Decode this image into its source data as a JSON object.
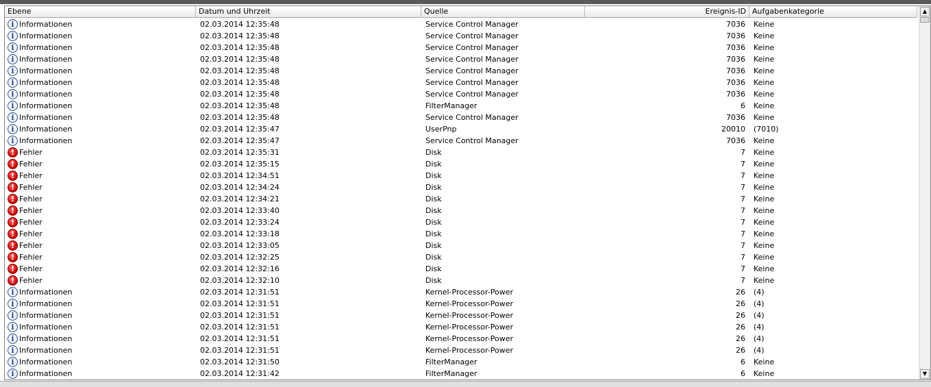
{
  "columns": [
    "Ebene",
    "Datum und Uhrzeit",
    "Quelle",
    "Ereignis-ID",
    "Aufgabenkategorie"
  ],
  "scroll": {
    "up_arrow": "▲",
    "down_arrow": "▼"
  },
  "rows": [
    {
      "level": "Informationen",
      "icon": "info-icon",
      "glyph": "i",
      "datetime": "02.03.2014 12:35:48",
      "source": "Service Control Manager",
      "id": "7036",
      "category": "Keine"
    },
    {
      "level": "Informationen",
      "icon": "info-icon",
      "glyph": "i",
      "datetime": "02.03.2014 12:35:48",
      "source": "Service Control Manager",
      "id": "7036",
      "category": "Keine"
    },
    {
      "level": "Informationen",
      "icon": "info-icon",
      "glyph": "i",
      "datetime": "02.03.2014 12:35:48",
      "source": "Service Control Manager",
      "id": "7036",
      "category": "Keine"
    },
    {
      "level": "Informationen",
      "icon": "info-icon",
      "glyph": "i",
      "datetime": "02.03.2014 12:35:48",
      "source": "Service Control Manager",
      "id": "7036",
      "category": "Keine"
    },
    {
      "level": "Informationen",
      "icon": "info-icon",
      "glyph": "i",
      "datetime": "02.03.2014 12:35:48",
      "source": "Service Control Manager",
      "id": "7036",
      "category": "Keine"
    },
    {
      "level": "Informationen",
      "icon": "info-icon",
      "glyph": "i",
      "datetime": "02.03.2014 12:35:48",
      "source": "Service Control Manager",
      "id": "7036",
      "category": "Keine"
    },
    {
      "level": "Informationen",
      "icon": "info-icon",
      "glyph": "i",
      "datetime": "02.03.2014 12:35:48",
      "source": "Service Control Manager",
      "id": "7036",
      "category": "Keine"
    },
    {
      "level": "Informationen",
      "icon": "info-icon",
      "glyph": "i",
      "datetime": "02.03.2014 12:35:48",
      "source": "FilterManager",
      "id": "6",
      "category": "Keine"
    },
    {
      "level": "Informationen",
      "icon": "info-icon",
      "glyph": "i",
      "datetime": "02.03.2014 12:35:48",
      "source": "Service Control Manager",
      "id": "7036",
      "category": "Keine"
    },
    {
      "level": "Informationen",
      "icon": "info-icon",
      "glyph": "i",
      "datetime": "02.03.2014 12:35:47",
      "source": "UserPnp",
      "id": "20010",
      "category": "(7010)"
    },
    {
      "level": "Informationen",
      "icon": "info-icon",
      "glyph": "i",
      "datetime": "02.03.2014 12:35:47",
      "source": "Service Control Manager",
      "id": "7036",
      "category": "Keine"
    },
    {
      "level": "Fehler",
      "icon": "error-icon",
      "glyph": "!",
      "datetime": "02.03.2014 12:35:31",
      "source": "Disk",
      "id": "7",
      "category": "Keine"
    },
    {
      "level": "Fehler",
      "icon": "error-icon",
      "glyph": "!",
      "datetime": "02.03.2014 12:35:15",
      "source": "Disk",
      "id": "7",
      "category": "Keine"
    },
    {
      "level": "Fehler",
      "icon": "error-icon",
      "glyph": "!",
      "datetime": "02.03.2014 12:34:51",
      "source": "Disk",
      "id": "7",
      "category": "Keine"
    },
    {
      "level": "Fehler",
      "icon": "error-icon",
      "glyph": "!",
      "datetime": "02.03.2014 12:34:24",
      "source": "Disk",
      "id": "7",
      "category": "Keine"
    },
    {
      "level": "Fehler",
      "icon": "error-icon",
      "glyph": "!",
      "datetime": "02.03.2014 12:34:21",
      "source": "Disk",
      "id": "7",
      "category": "Keine"
    },
    {
      "level": "Fehler",
      "icon": "error-icon",
      "glyph": "!",
      "datetime": "02.03.2014 12:33:40",
      "source": "Disk",
      "id": "7",
      "category": "Keine"
    },
    {
      "level": "Fehler",
      "icon": "error-icon",
      "glyph": "!",
      "datetime": "02.03.2014 12:33:24",
      "source": "Disk",
      "id": "7",
      "category": "Keine"
    },
    {
      "level": "Fehler",
      "icon": "error-icon",
      "glyph": "!",
      "datetime": "02.03.2014 12:33:18",
      "source": "Disk",
      "id": "7",
      "category": "Keine"
    },
    {
      "level": "Fehler",
      "icon": "error-icon",
      "glyph": "!",
      "datetime": "02.03.2014 12:33:05",
      "source": "Disk",
      "id": "7",
      "category": "Keine"
    },
    {
      "level": "Fehler",
      "icon": "error-icon",
      "glyph": "!",
      "datetime": "02.03.2014 12:32:25",
      "source": "Disk",
      "id": "7",
      "category": "Keine"
    },
    {
      "level": "Fehler",
      "icon": "error-icon",
      "glyph": "!",
      "datetime": "02.03.2014 12:32:16",
      "source": "Disk",
      "id": "7",
      "category": "Keine"
    },
    {
      "level": "Fehler",
      "icon": "error-icon",
      "glyph": "!",
      "datetime": "02.03.2014 12:32:10",
      "source": "Disk",
      "id": "7",
      "category": "Keine"
    },
    {
      "level": "Informationen",
      "icon": "info-icon",
      "glyph": "i",
      "datetime": "02.03.2014 12:31:51",
      "source": "Kernel-Processor-Power",
      "id": "26",
      "category": "(4)"
    },
    {
      "level": "Informationen",
      "icon": "info-icon",
      "glyph": "i",
      "datetime": "02.03.2014 12:31:51",
      "source": "Kernel-Processor-Power",
      "id": "26",
      "category": "(4)"
    },
    {
      "level": "Informationen",
      "icon": "info-icon",
      "glyph": "i",
      "datetime": "02.03.2014 12:31:51",
      "source": "Kernel-Processor-Power",
      "id": "26",
      "category": "(4)"
    },
    {
      "level": "Informationen",
      "icon": "info-icon",
      "glyph": "i",
      "datetime": "02.03.2014 12:31:51",
      "source": "Kernel-Processor-Power",
      "id": "26",
      "category": "(4)"
    },
    {
      "level": "Informationen",
      "icon": "info-icon",
      "glyph": "i",
      "datetime": "02.03.2014 12:31:51",
      "source": "Kernel-Processor-Power",
      "id": "26",
      "category": "(4)"
    },
    {
      "level": "Informationen",
      "icon": "info-icon",
      "glyph": "i",
      "datetime": "02.03.2014 12:31:51",
      "source": "Kernel-Processor-Power",
      "id": "26",
      "category": "(4)"
    },
    {
      "level": "Informationen",
      "icon": "info-icon",
      "glyph": "i",
      "datetime": "02.03.2014 12:31:50",
      "source": "FilterManager",
      "id": "6",
      "category": "Keine"
    },
    {
      "level": "Informationen",
      "icon": "info-icon",
      "glyph": "i",
      "datetime": "02.03.2014 12:31:42",
      "source": "FilterManager",
      "id": "6",
      "category": "Keine"
    }
  ]
}
